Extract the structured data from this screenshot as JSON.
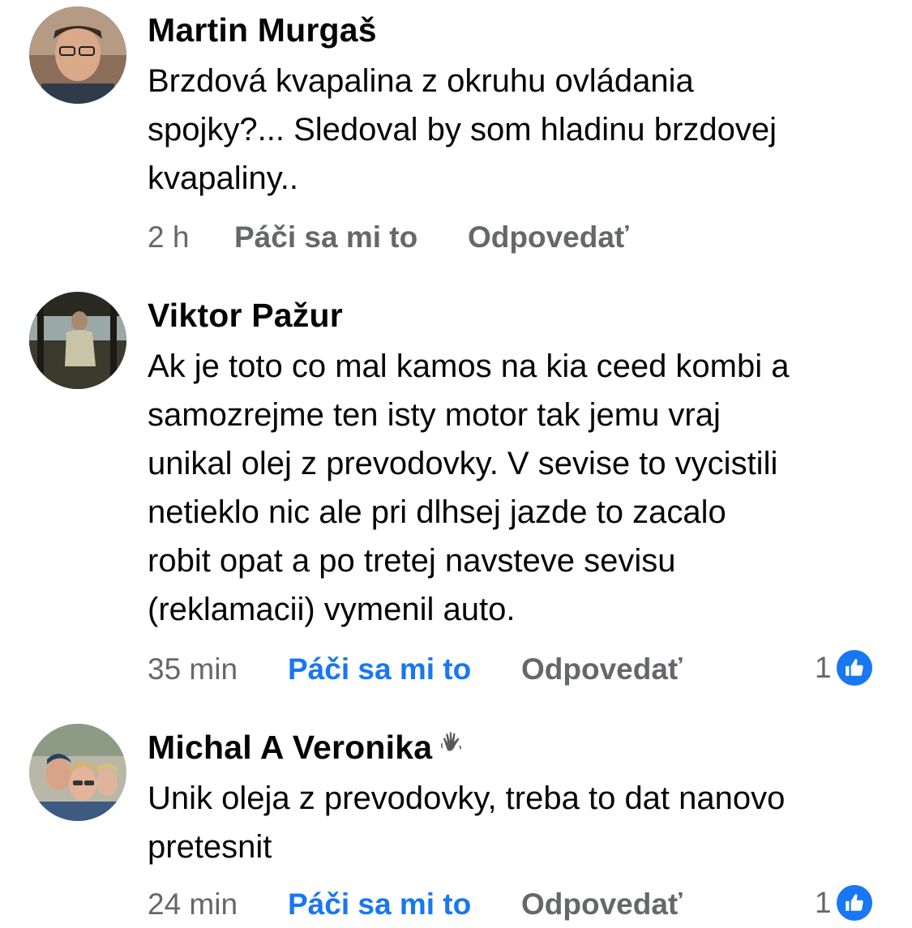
{
  "comments": [
    {
      "author": "Martin Murgaš",
      "text": "Brzdová kvapalina z okruhu ovládania\nspojky?... Sledoval by som hladinu brzdovej\nkvapaliny..",
      "time": "2 h",
      "like_label": "Páči sa mi to",
      "reply_label": "Odpovedať",
      "liked": false
    },
    {
      "author": "Viktor Pažur",
      "text": "Ak je toto co mal kamos na kia ceed kombi a\nsamozrejme ten isty motor tak jemu vraj\nunikal olej z prevodovky. V sevise to vycistili\nnetieklo nic ale pri dlhsej jazde to zacalo\nrobit opat a po tretej navsteve sevisu\n(reklamacii) vymenil auto.",
      "time": "35 min",
      "like_label": "Páči sa mi to",
      "reply_label": "Odpovedať",
      "liked": true,
      "reaction_count": "1",
      "reaction_icon": "thumbs-up-icon"
    },
    {
      "author": "Michal A Veronika",
      "author_badge_icon": "waving-hand-icon",
      "text": "Unik oleja z prevodovky, treba to dat nanovo\npretesnit",
      "time": "24 min",
      "like_label": "Páči sa mi to",
      "reply_label": "Odpovedať",
      "liked": true,
      "reaction_count": "1",
      "reaction_icon": "thumbs-up-icon"
    }
  ],
  "colors": {
    "text": "#050505",
    "meta_gray": "#65676b",
    "like_blue": "#1877f2"
  }
}
